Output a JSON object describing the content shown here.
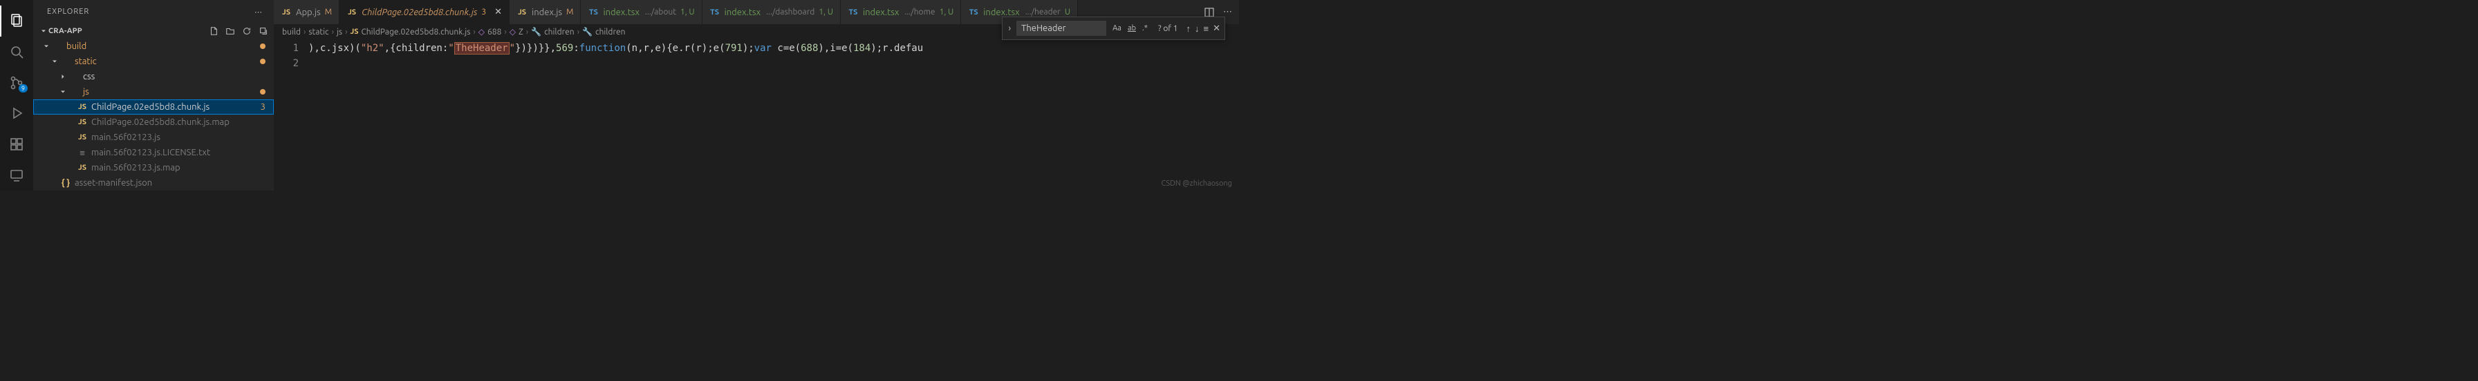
{
  "activity": {
    "badge": "9"
  },
  "sidebar": {
    "title": "EXPLORER",
    "section": "CRA-APP",
    "tree": [
      {
        "label": "build",
        "kind": "folder-open",
        "depth": 0,
        "cls": "folder-orange",
        "badge": "dot"
      },
      {
        "label": "static",
        "kind": "folder-open",
        "depth": 1,
        "cls": "folder-orange",
        "badge": "dot"
      },
      {
        "label": "css",
        "kind": "folder-closed",
        "depth": 2
      },
      {
        "label": "js",
        "kind": "folder-open",
        "depth": 2,
        "cls": "folder-orange",
        "badge": "dot"
      },
      {
        "label": "ChildPage.02ed5bd8.chunk.js",
        "kind": "js",
        "depth": 3,
        "selected": true,
        "badge": "3"
      },
      {
        "label": "ChildPage.02ed5bd8.chunk.js.map",
        "kind": "js",
        "depth": 3,
        "cls": "dimmed"
      },
      {
        "label": "main.56f02123.js",
        "kind": "js",
        "depth": 3,
        "cls": "dimmed"
      },
      {
        "label": "main.56f02123.js.LICENSE.txt",
        "kind": "txt",
        "depth": 3,
        "cls": "dimmed"
      },
      {
        "label": "main.56f02123.js.map",
        "kind": "js",
        "depth": 3,
        "cls": "dimmed"
      },
      {
        "label": "asset-manifest.json",
        "kind": "json",
        "depth": 1,
        "cls": "dimmed"
      }
    ]
  },
  "tabs": [
    {
      "icon": "js",
      "label": "App.js",
      "status": "M",
      "statusCls": "m"
    },
    {
      "icon": "js",
      "label": "ChildPage.02ed5bd8.chunk.js",
      "status": "3",
      "statusCls": "num",
      "active": true,
      "modified": true,
      "italic": true,
      "close": true
    },
    {
      "icon": "js",
      "label": "index.js",
      "status": "M",
      "statusCls": "m"
    },
    {
      "icon": "ts",
      "label": "index.tsx",
      "desc": ".../about",
      "status": "1, U",
      "statusCls": "u",
      "untracked": true
    },
    {
      "icon": "ts",
      "label": "index.tsx",
      "desc": ".../dashboard",
      "status": "1, U",
      "statusCls": "u",
      "untracked": true
    },
    {
      "icon": "ts",
      "label": "index.tsx",
      "desc": ".../home",
      "status": "1, U",
      "statusCls": "u",
      "untracked": true
    },
    {
      "icon": "ts",
      "label": "index.tsx",
      "desc": ".../header",
      "status": "U",
      "statusCls": "u",
      "untracked": true
    }
  ],
  "breadcrumbs": {
    "parts": [
      "build",
      "static",
      "js"
    ],
    "file": "ChildPage.02ed5bd8.chunk.js",
    "symbols": [
      "688",
      "Z",
      "children",
      "children"
    ]
  },
  "editor": {
    "lines": [
      "1",
      "2"
    ],
    "code_pre": "),c.jsx)(",
    "code_h2": "\"h2\"",
    "code_mid1": ",{children:",
    "code_theheader_open": "\"",
    "code_theheader": "TheHeader",
    "code_theheader_close": "\"",
    "code_post1": "})})}},",
    "code_569": "569",
    "code_post2": ":",
    "code_func": "function",
    "code_args": "(n,r,e){e.r(r);e(",
    "code_791": "791",
    "code_post3": ");",
    "code_var": "var",
    "code_post4": " c=e(",
    "code_688": "688",
    "code_post5": "),i=e(",
    "code_184": "184",
    "code_post6": ");r.defau"
  },
  "find": {
    "value": "TheHeader",
    "status": "? of 1"
  },
  "watermark": "CSDN @zhichaosong"
}
